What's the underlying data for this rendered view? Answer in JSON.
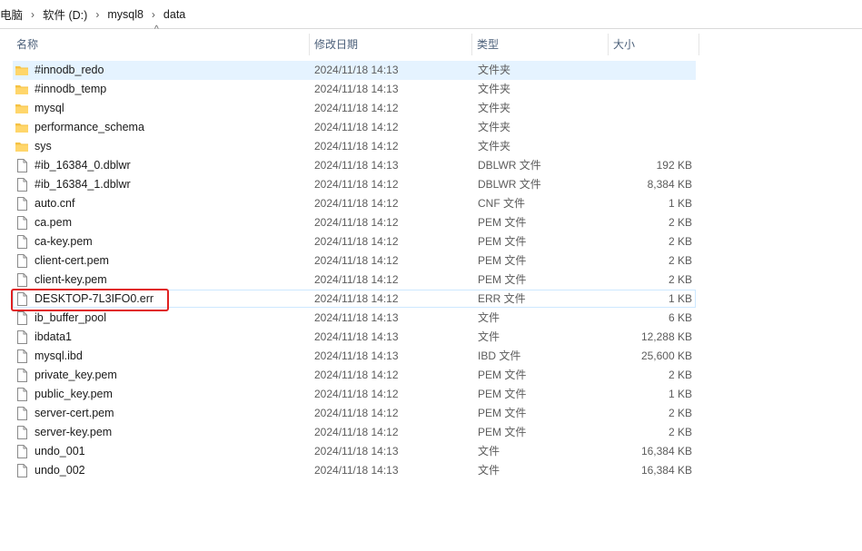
{
  "breadcrumb": {
    "items": [
      "电脑",
      "软件 (D:)",
      "mysql8",
      "data"
    ],
    "separator": "›"
  },
  "columns": {
    "name": "名称",
    "date": "修改日期",
    "type": "类型",
    "size": "大小"
  },
  "sort_indicator": "^",
  "colors": {
    "folder": "#f5c244",
    "selected_bg": "#e5f3ff",
    "highlight": "#e02020"
  },
  "files": [
    {
      "name": "#innodb_redo",
      "date": "2024/11/18 14:13",
      "type": "文件夹",
      "size": "",
      "icon": "folder-icon"
    },
    {
      "name": "#innodb_temp",
      "date": "2024/11/18 14:13",
      "type": "文件夹",
      "size": "",
      "icon": "folder-icon"
    },
    {
      "name": "mysql",
      "date": "2024/11/18 14:12",
      "type": "文件夹",
      "size": "",
      "icon": "folder-icon"
    },
    {
      "name": "performance_schema",
      "date": "2024/11/18 14:12",
      "type": "文件夹",
      "size": "",
      "icon": "folder-icon"
    },
    {
      "name": "sys",
      "date": "2024/11/18 14:12",
      "type": "文件夹",
      "size": "",
      "icon": "folder-icon"
    },
    {
      "name": "#ib_16384_0.dblwr",
      "date": "2024/11/18 14:13",
      "type": "DBLWR 文件",
      "size": "192 KB",
      "icon": "file-icon"
    },
    {
      "name": "#ib_16384_1.dblwr",
      "date": "2024/11/18 14:12",
      "type": "DBLWR 文件",
      "size": "8,384 KB",
      "icon": "file-icon"
    },
    {
      "name": "auto.cnf",
      "date": "2024/11/18 14:12",
      "type": "CNF 文件",
      "size": "1 KB",
      "icon": "file-icon"
    },
    {
      "name": "ca.pem",
      "date": "2024/11/18 14:12",
      "type": "PEM 文件",
      "size": "2 KB",
      "icon": "file-icon"
    },
    {
      "name": "ca-key.pem",
      "date": "2024/11/18 14:12",
      "type": "PEM 文件",
      "size": "2 KB",
      "icon": "file-icon"
    },
    {
      "name": "client-cert.pem",
      "date": "2024/11/18 14:12",
      "type": "PEM 文件",
      "size": "2 KB",
      "icon": "file-icon"
    },
    {
      "name": "client-key.pem",
      "date": "2024/11/18 14:12",
      "type": "PEM 文件",
      "size": "2 KB",
      "icon": "file-icon"
    },
    {
      "name": "DESKTOP-7L3IFO0.err",
      "date": "2024/11/18 14:12",
      "type": "ERR 文件",
      "size": "1 KB",
      "icon": "file-icon"
    },
    {
      "name": "ib_buffer_pool",
      "date": "2024/11/18 14:13",
      "type": "文件",
      "size": "6 KB",
      "icon": "file-icon"
    },
    {
      "name": "ibdata1",
      "date": "2024/11/18 14:13",
      "type": "文件",
      "size": "12,288 KB",
      "icon": "file-icon"
    },
    {
      "name": "mysql.ibd",
      "date": "2024/11/18 14:13",
      "type": "IBD 文件",
      "size": "25,600 KB",
      "icon": "file-icon"
    },
    {
      "name": "private_key.pem",
      "date": "2024/11/18 14:12",
      "type": "PEM 文件",
      "size": "2 KB",
      "icon": "file-icon"
    },
    {
      "name": "public_key.pem",
      "date": "2024/11/18 14:12",
      "type": "PEM 文件",
      "size": "1 KB",
      "icon": "file-icon"
    },
    {
      "name": "server-cert.pem",
      "date": "2024/11/18 14:12",
      "type": "PEM 文件",
      "size": "2 KB",
      "icon": "file-icon"
    },
    {
      "name": "server-key.pem",
      "date": "2024/11/18 14:12",
      "type": "PEM 文件",
      "size": "2 KB",
      "icon": "file-icon"
    },
    {
      "name": "undo_001",
      "date": "2024/11/18 14:13",
      "type": "文件",
      "size": "16,384 KB",
      "icon": "file-icon"
    },
    {
      "name": "undo_002",
      "date": "2024/11/18 14:13",
      "type": "文件",
      "size": "16,384 KB",
      "icon": "file-icon"
    }
  ]
}
